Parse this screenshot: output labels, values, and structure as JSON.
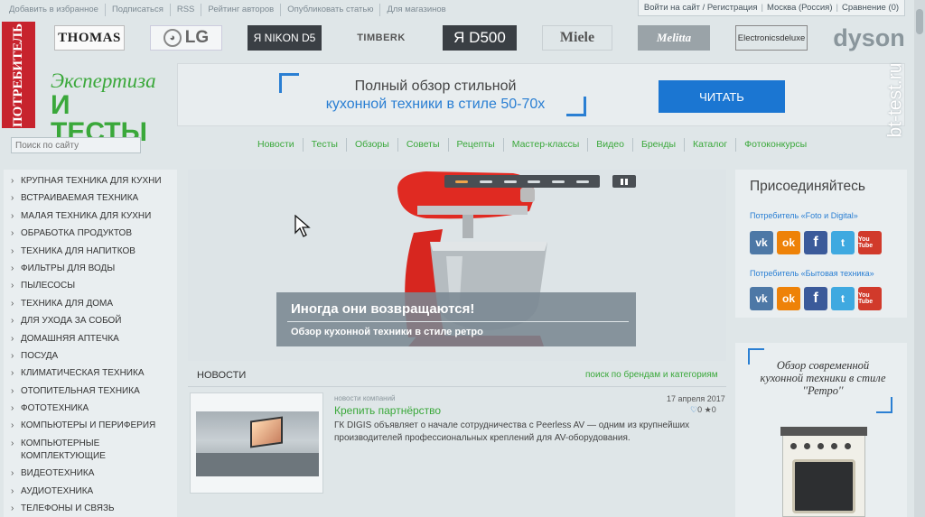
{
  "top_links": [
    "Добавить в избранное",
    "Подписаться",
    "RSS",
    "Рейтинг авторов",
    "Опубликовать статью",
    "Для магазинов"
  ],
  "user_bar": {
    "login": "Войти на сайт / Регистрация",
    "city": "Москва (Россия)",
    "compare": "Сравнение (0)"
  },
  "brands": {
    "thomas": "THOMAS",
    "lg": "LG",
    "nikon": "Я NIKON D5",
    "timberk": "TIMBERK",
    "d500": "Я D500",
    "miele": "Miele",
    "melitta": "Melitta",
    "electronics": "Electronicsdeluxe",
    "dyson": "dyson"
  },
  "logo": {
    "red_text": "ПОТРЕБИТЕЛЬ",
    "line1": "Экспертиза",
    "line2": "И ТЕСТЫ"
  },
  "banner": {
    "line1": "Полный обзор стильной",
    "line2": "кухонной техники в стиле 50-70х",
    "button": "ЧИТАТЬ"
  },
  "search": {
    "placeholder": "Поиск по сайту"
  },
  "nav": [
    "Новости",
    "Тесты",
    "Обзоры",
    "Советы",
    "Рецепты",
    "Мастер-классы",
    "Видео",
    "Бренды",
    "Каталог",
    "Фотоконкурсы"
  ],
  "sidebar": [
    "КРУПНАЯ ТЕХНИКА ДЛЯ КУХНИ",
    "ВСТРАИВАЕМАЯ ТЕХНИКА",
    "МАЛАЯ ТЕХНИКА ДЛЯ КУХНИ",
    "ОБРАБОТКА ПРОДУКТОВ",
    "ТЕХНИКА ДЛЯ НАПИТКОВ",
    "ФИЛЬТРЫ ДЛЯ ВОДЫ",
    "ПЫЛЕСОСЫ",
    "ТЕХНИКА ДЛЯ ДОМА",
    "ДЛЯ УХОДА ЗА СОБОЙ",
    "ДОМАШНЯЯ АПТЕЧКА",
    "ПОСУДА",
    "КЛИМАТИЧЕСКАЯ ТЕХНИКА",
    "ОТОПИТЕЛЬНАЯ ТЕХНИКА",
    "ФОТОТЕХНИКА",
    "КОМПЬЮТЕРЫ И ПЕРИФЕРИЯ",
    "КОМПЬЮТЕРНЫЕ КОМПЛЕКТУЮЩИЕ",
    "ВИДЕОТЕХНИКА",
    "АУДИОТЕХНИКА",
    "ТЕЛЕФОНЫ И СВЯЗЬ"
  ],
  "slider": {
    "title": "Иногда они возвращаются!",
    "subtitle": "Обзор кухонной техники в стиле ретро",
    "slide_count": 6,
    "active_slide": 1
  },
  "news": {
    "heading": "НОВОСТИ",
    "link": "поиск по брендам и категориям",
    "item": {
      "category": "новости компаний",
      "date": "17 апреля 2017",
      "title": "Крепить партнёрство",
      "likes": "0",
      "stars": "0",
      "text": "ГК DIGIS объявляет о начале сотрудничества с Peerless AV — одним из крупнейших производителей профессиональных креплений для AV-оборудования."
    }
  },
  "social": {
    "heading": "Присоединяйтесь",
    "group1": "Потребитель «Foto и Digital»",
    "group2": "Потребитель «Бытовая техника»",
    "icons": {
      "vk": "vk",
      "ok": "ok",
      "fb": "f",
      "tw": "t",
      "yt": "You Tube"
    }
  },
  "ad": {
    "text": "Обзор современной кухонной техники в стиле ''Ретро''"
  },
  "watermark": "bt-test.ru",
  "colors": {
    "accent_green": "#3aa83a",
    "accent_blue": "#2a7fd3",
    "logo_red": "#c7232d",
    "button_blue": "#1b76d2"
  }
}
